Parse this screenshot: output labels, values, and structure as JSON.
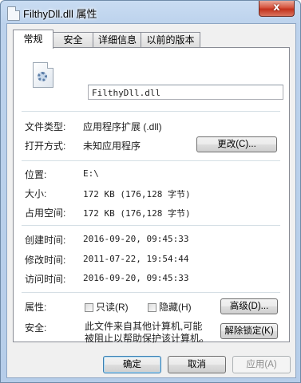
{
  "window": {
    "title": "FilthyDll.dll 属性",
    "close_label": "x"
  },
  "tabs": [
    {
      "label": "常规",
      "active": true
    },
    {
      "label": "安全",
      "active": false
    },
    {
      "label": "详细信息",
      "active": false
    },
    {
      "label": "以前的版本",
      "active": false
    }
  ],
  "general": {
    "icon": "dll-gear-icon",
    "file_name": "FilthyDll.dll",
    "type_label": "文件类型:",
    "type_value": "应用程序扩展 (.dll)",
    "opens_with_label": "打开方式:",
    "opens_with_value": "未知应用程序",
    "change_button": "更改(C)...",
    "location_label": "位置:",
    "location_value": "E:\\",
    "size_label": "大小:",
    "size_value": "172 KB (176,128 字节)",
    "size_on_disk_label": "占用空间:",
    "size_on_disk_value": "172 KB (176,128 字节)",
    "created_label": "创建时间:",
    "created_value": "2016-09-20, 09:45:33",
    "modified_label": "修改时间:",
    "modified_value": "2011-07-22, 19:54:44",
    "accessed_label": "访问时间:",
    "accessed_value": "2016-09-20, 09:45:33",
    "attributes_label": "属性:",
    "readonly_label": "只读(R)",
    "readonly_checked": false,
    "hidden_label": "隐藏(H)",
    "hidden_checked": false,
    "advanced_button": "高级(D)...",
    "security_label": "安全:",
    "security_line1": "此文件来自其他计算机,可能",
    "security_line2": "被阻止以帮助保护该计算机。",
    "unblock_button": "解除锁定(K)"
  },
  "footer": {
    "ok_button": "确定",
    "cancel_button": "取消",
    "apply_button": "应用(A)"
  }
}
